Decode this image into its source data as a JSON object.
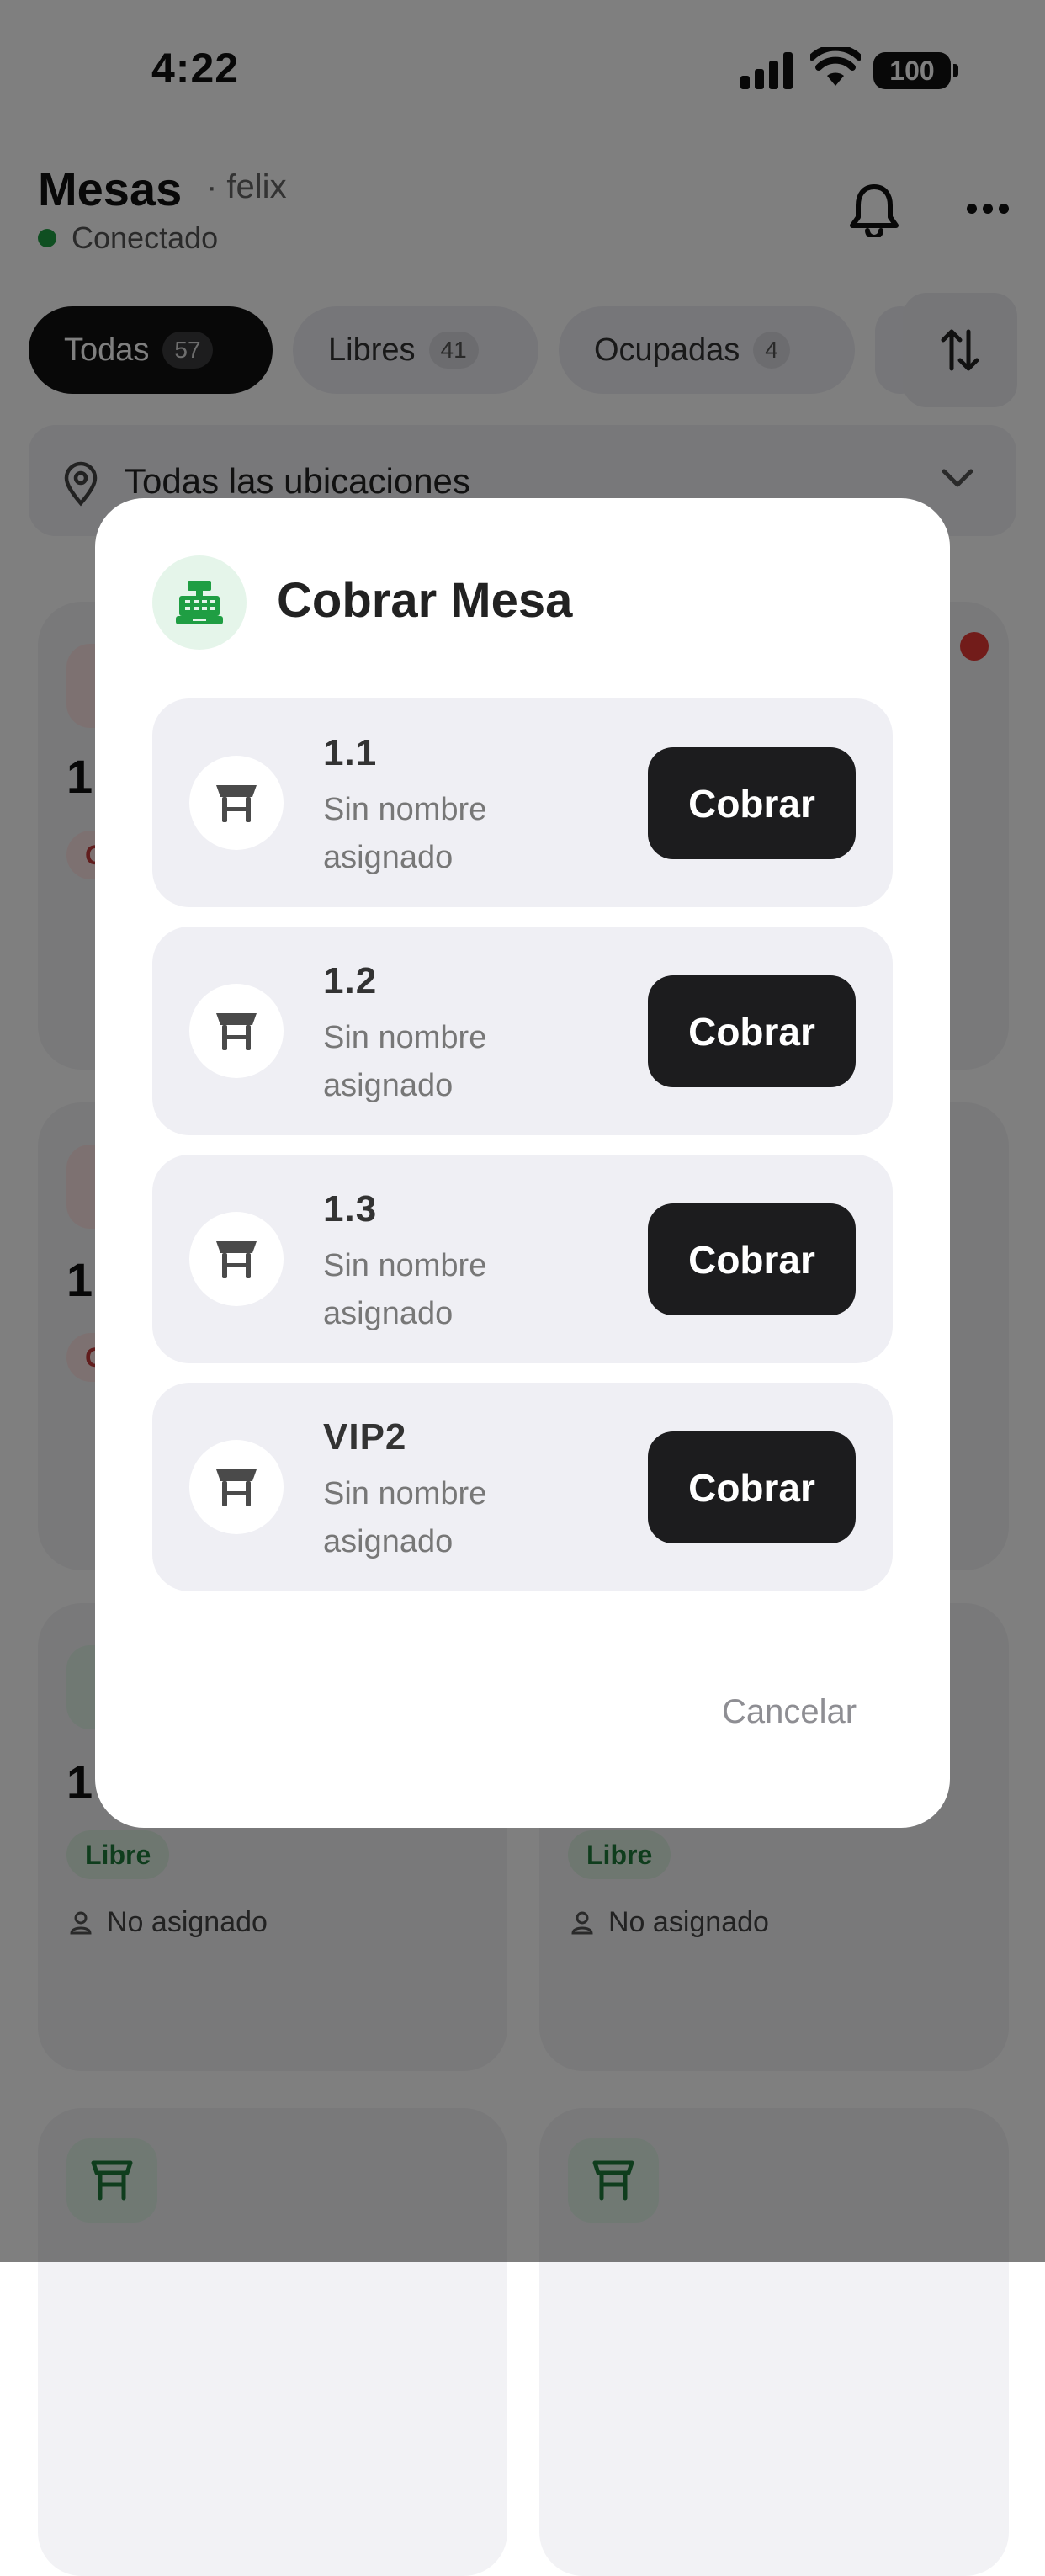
{
  "status": {
    "time": "4:22",
    "battery": "100"
  },
  "header": {
    "title": "Mesas",
    "user": "· felix",
    "connection": "Conectado"
  },
  "filters": [
    {
      "label": "Todas",
      "count": "57"
    },
    {
      "label": "Libres",
      "count": "41"
    },
    {
      "label": "Ocupadas",
      "count": "4"
    }
  ],
  "location": {
    "label": "Todas las ubicaciones"
  },
  "cards": {
    "card1_num": "1",
    "card1_pill": "O",
    "card2_num": "1",
    "card2_pill": "O",
    "card3_num": "1",
    "card3_pill": "Libre",
    "card3_assign": "No asignado",
    "card4_pill": "Libre",
    "card4_assign": "No asignado"
  },
  "modal": {
    "title": "Cobrar Mesa",
    "tables": [
      {
        "name": "1.1",
        "subtitle": "Sin nombre asignado",
        "action": "Cobrar"
      },
      {
        "name": "1.2",
        "subtitle": "Sin nombre asignado",
        "action": "Cobrar"
      },
      {
        "name": "1.3",
        "subtitle": "Sin nombre asignado",
        "action": "Cobrar"
      },
      {
        "name": "VIP2",
        "subtitle": "Sin nombre asignado",
        "action": "Cobrar"
      }
    ],
    "cancel": "Cancelar"
  },
  "icons": {
    "modal": "cash-register-icon",
    "row": "table-icon"
  },
  "colors": {
    "accent_green": "#1f9e43",
    "dark_button": "#1c1c1e",
    "unread_dot": "#e53935"
  }
}
